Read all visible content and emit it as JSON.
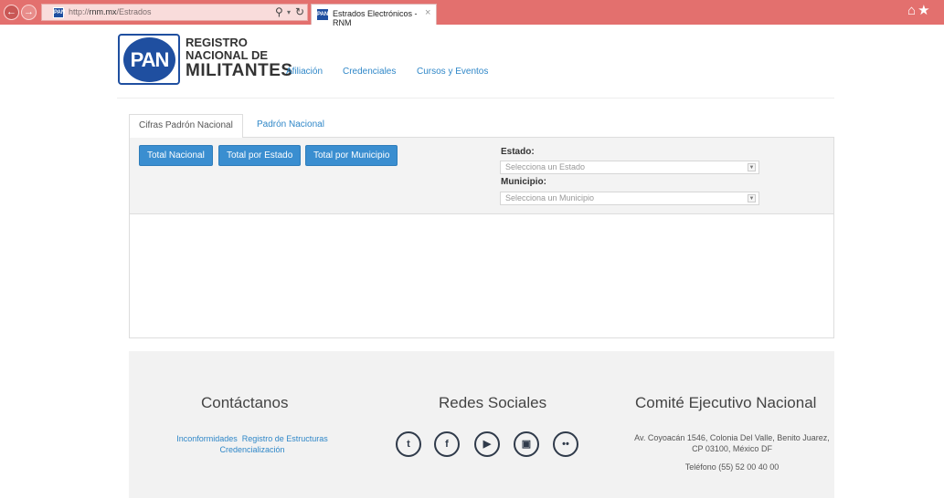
{
  "browser": {
    "url_prefix": "http://",
    "url_domain": "rnm.mx",
    "url_path": "/Estrados",
    "tab_title": "Estrados Electrónicos - RNM",
    "favicon_text": "PAN",
    "icons": [
      "back-arrow-icon",
      "forward-arrow-icon",
      "search-icon",
      "refresh-icon",
      "close-icon",
      "home-icon",
      "star-icon"
    ]
  },
  "header": {
    "logo_text": "PAN",
    "brand_line1": "REGISTRO",
    "brand_line2": "NACIONAL DE",
    "brand_line3": "MILITANTES",
    "nav": [
      "Afiliación",
      "Credenciales",
      "Cursos y Eventos"
    ]
  },
  "tabs": {
    "active": "Cifras Padrón Nacional",
    "inactive": "Padrón Nacional"
  },
  "filters": {
    "buttons": [
      "Total Nacional",
      "Total por Estado",
      "Total por Municipio"
    ],
    "estado_label": "Estado:",
    "estado_placeholder": "Selecciona un Estado",
    "municipio_label": "Municipio:",
    "municipio_placeholder": "Selecciona un Municipio"
  },
  "footer": {
    "contact_title": "Contáctanos",
    "contact_links": [
      "Inconformidades",
      "Registro de Estructuras",
      "Credencialización"
    ],
    "social_title": "Redes Sociales",
    "social_icons": [
      "twitter-icon",
      "facebook-icon",
      "youtube-icon",
      "instagram-icon",
      "flickr-icon"
    ],
    "committee_title": "Comité Ejecutivo Nacional",
    "address": "Av. Coyoacán 1546, Colonia Del Valle, Benito Juarez, CP 03100, México DF",
    "phone": "Teléfono (55) 52 00 40 00"
  },
  "colors": {
    "chrome": "#e3706e",
    "accent": "#3a8ed0",
    "brand_blue": "#1f4fa0",
    "link": "#2f87c8"
  }
}
